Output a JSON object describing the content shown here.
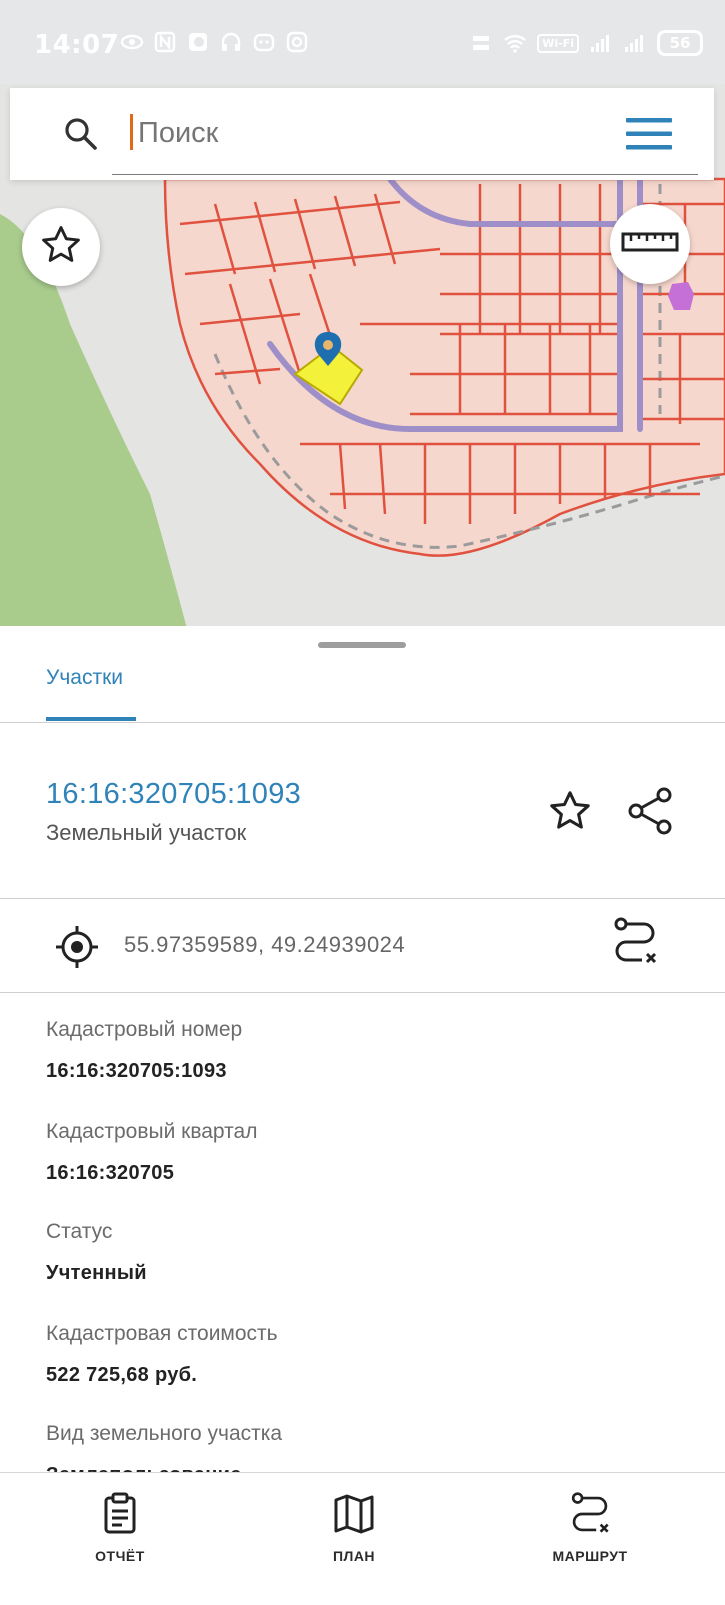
{
  "status_bar": {
    "time": "14:07",
    "network_badge": "Wi-Fi",
    "battery": "56"
  },
  "search": {
    "placeholder": "Поиск"
  },
  "sheet": {
    "tab_label": "Участки",
    "parcel_id": "16:16:320705:1093",
    "parcel_type": "Земельный участок",
    "coordinates": "55.97359589, 49.24939024",
    "fields": [
      {
        "label": "Кадастровый номер",
        "value": "16:16:320705:1093"
      },
      {
        "label": "Кадастровый квартал",
        "value": "16:16:320705"
      },
      {
        "label": "Статус",
        "value": "Учтенный"
      },
      {
        "label": "Кадастровая стоимость",
        "value": "522 725,68 руб."
      },
      {
        "label": "Вид земельного участка",
        "value": "Землепользование"
      }
    ]
  },
  "bottom_nav": {
    "report": "ОТЧЁТ",
    "plan": "ПЛАН",
    "route": "МАРШРУТ"
  },
  "colors": {
    "accent": "#2f83b8",
    "parcel_fill": "#f6d7cd",
    "parcel_border": "#e0523f",
    "road": "#9f8fc8",
    "forest": "#a9cc8d",
    "selected_parcel": "#f4f13a"
  },
  "icons": {
    "search": "search-icon",
    "menu": "hamburger-menu-icon",
    "favorite": "star-icon",
    "ruler": "ruler-icon",
    "share": "share-icon",
    "location": "crosshair-icon",
    "route": "route-icon",
    "report": "clipboard-icon",
    "plan": "map-icon",
    "marker": "map-pin-icon"
  }
}
